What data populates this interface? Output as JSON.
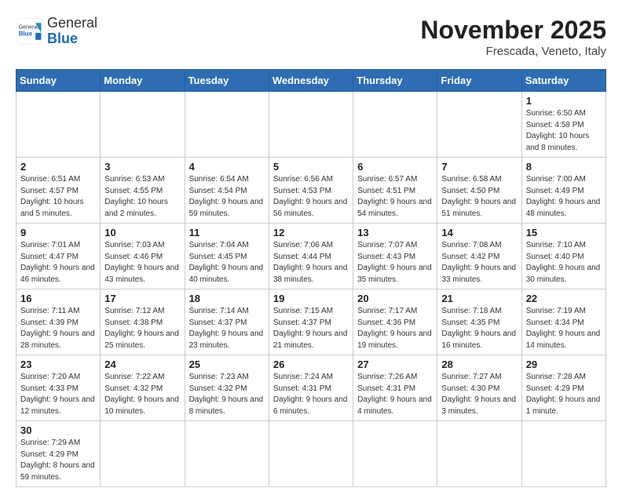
{
  "header": {
    "logo_general": "General",
    "logo_blue": "Blue",
    "month_title": "November 2025",
    "location": "Frescada, Veneto, Italy"
  },
  "days_of_week": [
    "Sunday",
    "Monday",
    "Tuesday",
    "Wednesday",
    "Thursday",
    "Friday",
    "Saturday"
  ],
  "weeks": [
    [
      {
        "day": "",
        "info": ""
      },
      {
        "day": "",
        "info": ""
      },
      {
        "day": "",
        "info": ""
      },
      {
        "day": "",
        "info": ""
      },
      {
        "day": "",
        "info": ""
      },
      {
        "day": "",
        "info": ""
      },
      {
        "day": "1",
        "info": "Sunrise: 6:50 AM\nSunset: 4:58 PM\nDaylight: 10 hours\nand 8 minutes."
      }
    ],
    [
      {
        "day": "2",
        "info": "Sunrise: 6:51 AM\nSunset: 4:57 PM\nDaylight: 10 hours\nand 5 minutes."
      },
      {
        "day": "3",
        "info": "Sunrise: 6:53 AM\nSunset: 4:55 PM\nDaylight: 10 hours\nand 2 minutes."
      },
      {
        "day": "4",
        "info": "Sunrise: 6:54 AM\nSunset: 4:54 PM\nDaylight: 9 hours\nand 59 minutes."
      },
      {
        "day": "5",
        "info": "Sunrise: 6:56 AM\nSunset: 4:53 PM\nDaylight: 9 hours\nand 56 minutes."
      },
      {
        "day": "6",
        "info": "Sunrise: 6:57 AM\nSunset: 4:51 PM\nDaylight: 9 hours\nand 54 minutes."
      },
      {
        "day": "7",
        "info": "Sunrise: 6:58 AM\nSunset: 4:50 PM\nDaylight: 9 hours\nand 51 minutes."
      },
      {
        "day": "8",
        "info": "Sunrise: 7:00 AM\nSunset: 4:49 PM\nDaylight: 9 hours\nand 48 minutes."
      }
    ],
    [
      {
        "day": "9",
        "info": "Sunrise: 7:01 AM\nSunset: 4:47 PM\nDaylight: 9 hours\nand 46 minutes."
      },
      {
        "day": "10",
        "info": "Sunrise: 7:03 AM\nSunset: 4:46 PM\nDaylight: 9 hours\nand 43 minutes."
      },
      {
        "day": "11",
        "info": "Sunrise: 7:04 AM\nSunset: 4:45 PM\nDaylight: 9 hours\nand 40 minutes."
      },
      {
        "day": "12",
        "info": "Sunrise: 7:06 AM\nSunset: 4:44 PM\nDaylight: 9 hours\nand 38 minutes."
      },
      {
        "day": "13",
        "info": "Sunrise: 7:07 AM\nSunset: 4:43 PM\nDaylight: 9 hours\nand 35 minutes."
      },
      {
        "day": "14",
        "info": "Sunrise: 7:08 AM\nSunset: 4:42 PM\nDaylight: 9 hours\nand 33 minutes."
      },
      {
        "day": "15",
        "info": "Sunrise: 7:10 AM\nSunset: 4:40 PM\nDaylight: 9 hours\nand 30 minutes."
      }
    ],
    [
      {
        "day": "16",
        "info": "Sunrise: 7:11 AM\nSunset: 4:39 PM\nDaylight: 9 hours\nand 28 minutes."
      },
      {
        "day": "17",
        "info": "Sunrise: 7:12 AM\nSunset: 4:38 PM\nDaylight: 9 hours\nand 25 minutes."
      },
      {
        "day": "18",
        "info": "Sunrise: 7:14 AM\nSunset: 4:37 PM\nDaylight: 9 hours\nand 23 minutes."
      },
      {
        "day": "19",
        "info": "Sunrise: 7:15 AM\nSunset: 4:37 PM\nDaylight: 9 hours\nand 21 minutes."
      },
      {
        "day": "20",
        "info": "Sunrise: 7:17 AM\nSunset: 4:36 PM\nDaylight: 9 hours\nand 19 minutes."
      },
      {
        "day": "21",
        "info": "Sunrise: 7:18 AM\nSunset: 4:35 PM\nDaylight: 9 hours\nand 16 minutes."
      },
      {
        "day": "22",
        "info": "Sunrise: 7:19 AM\nSunset: 4:34 PM\nDaylight: 9 hours\nand 14 minutes."
      }
    ],
    [
      {
        "day": "23",
        "info": "Sunrise: 7:20 AM\nSunset: 4:33 PM\nDaylight: 9 hours\nand 12 minutes."
      },
      {
        "day": "24",
        "info": "Sunrise: 7:22 AM\nSunset: 4:32 PM\nDaylight: 9 hours\nand 10 minutes."
      },
      {
        "day": "25",
        "info": "Sunrise: 7:23 AM\nSunset: 4:32 PM\nDaylight: 9 hours\nand 8 minutes."
      },
      {
        "day": "26",
        "info": "Sunrise: 7:24 AM\nSunset: 4:31 PM\nDaylight: 9 hours\nand 6 minutes."
      },
      {
        "day": "27",
        "info": "Sunrise: 7:26 AM\nSunset: 4:31 PM\nDaylight: 9 hours\nand 4 minutes."
      },
      {
        "day": "28",
        "info": "Sunrise: 7:27 AM\nSunset: 4:30 PM\nDaylight: 9 hours\nand 3 minutes."
      },
      {
        "day": "29",
        "info": "Sunrise: 7:28 AM\nSunset: 4:29 PM\nDaylight: 9 hours\nand 1 minute."
      }
    ],
    [
      {
        "day": "30",
        "info": "Sunrise: 7:29 AM\nSunset: 4:29 PM\nDaylight: 8 hours\nand 59 minutes."
      },
      {
        "day": "",
        "info": ""
      },
      {
        "day": "",
        "info": ""
      },
      {
        "day": "",
        "info": ""
      },
      {
        "day": "",
        "info": ""
      },
      {
        "day": "",
        "info": ""
      },
      {
        "day": "",
        "info": ""
      }
    ]
  ]
}
